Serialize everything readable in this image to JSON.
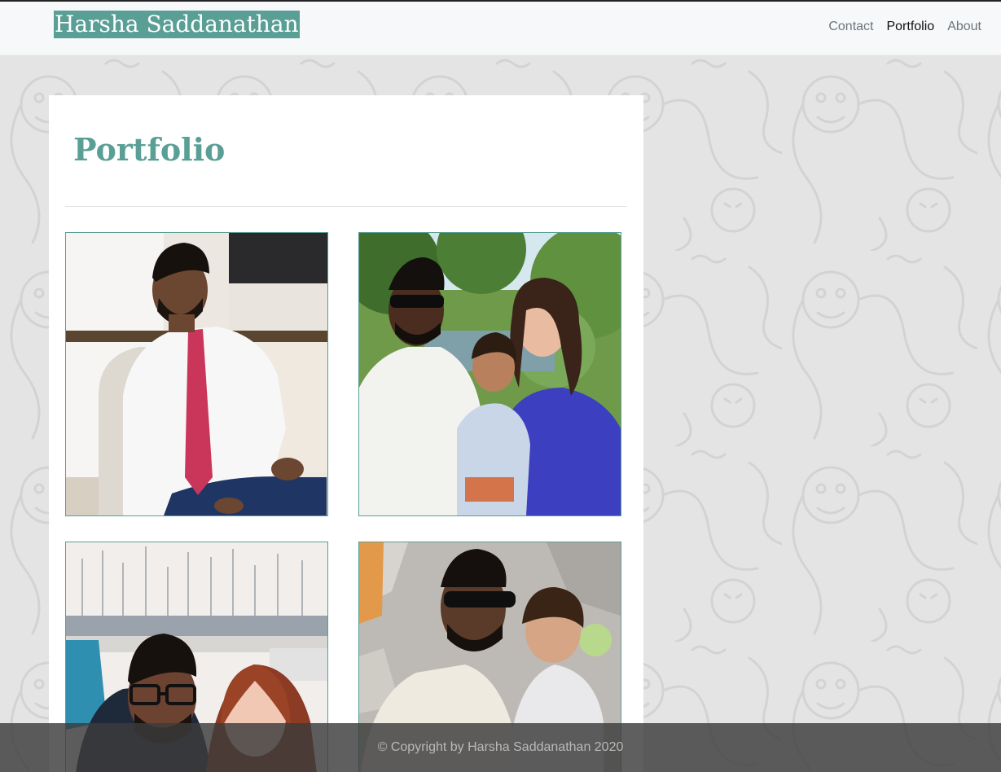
{
  "header": {
    "brand": "Harsha Saddanathan",
    "nav": [
      {
        "label": "Contact",
        "active": false
      },
      {
        "label": "Portfolio",
        "active": true
      },
      {
        "label": "About",
        "active": false
      }
    ]
  },
  "main": {
    "title": "Portfolio",
    "photos": [
      {
        "subject": "man in white shirt and red tie seated indoors"
      },
      {
        "subject": "family portrait with child outdoors near trees"
      },
      {
        "subject": "couple selfie at a marina with sailboats"
      },
      {
        "subject": "man in sunglasses holding child near stone wall"
      }
    ]
  },
  "footer": {
    "copyright": "© Copyright by Harsha Saddanathan 2020"
  },
  "colors": {
    "accent": "#5a9f95",
    "navbar_bg": "#f7f8f9",
    "page_bg": "#e4e4e4",
    "footer_bg": "#3c3c3c"
  }
}
